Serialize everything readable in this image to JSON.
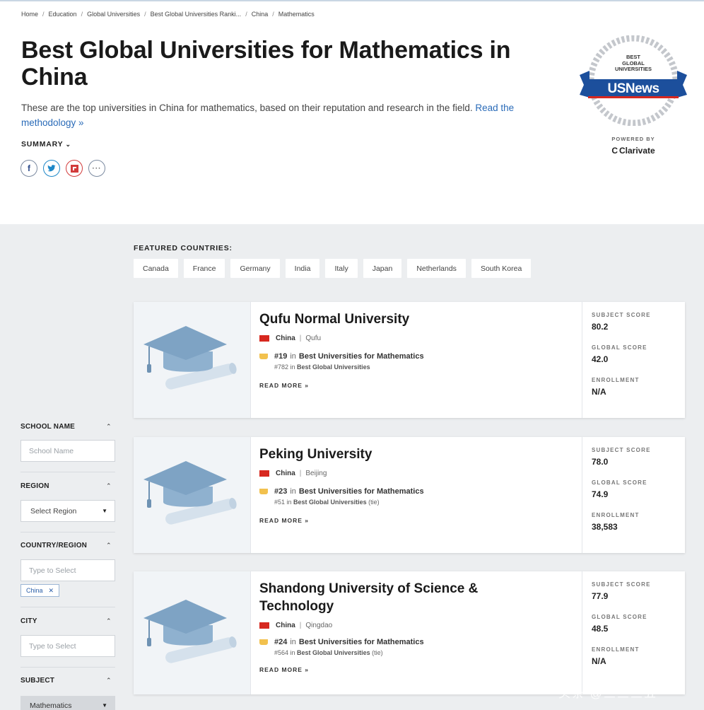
{
  "breadcrumb": [
    "Home",
    "Education",
    "Global Universities",
    "Best Global Universities Ranki...",
    "China",
    "Mathematics"
  ],
  "header": {
    "title": "Best Global Universities for Mathematics in China",
    "intro": "These are the top universities in China for mathematics, based on their reputation and research in the field.",
    "methodology_link": "Read the methodology »",
    "summary_label": "SUMMARY",
    "share_icons": [
      "facebook-icon",
      "twitter-icon",
      "flipboard-icon",
      "more-icon"
    ]
  },
  "badge": {
    "line1": "BEST",
    "line2": "GLOBAL",
    "line3": "UNIVERSITIES",
    "brand": "USNews",
    "powered_by": "POWERED BY",
    "partner": "Clarivate"
  },
  "featured": {
    "label": "FEATURED COUNTRIES:",
    "countries": [
      "Canada",
      "France",
      "Germany",
      "India",
      "Italy",
      "Japan",
      "Netherlands",
      "South Korea"
    ]
  },
  "filters": {
    "school_name": {
      "label": "SCHOOL NAME",
      "placeholder": "School Name"
    },
    "region": {
      "label": "REGION",
      "value": "Select Region"
    },
    "country_region": {
      "label": "COUNTRY/REGION",
      "placeholder": "Type to Select",
      "tag": "China"
    },
    "city": {
      "label": "CITY",
      "placeholder": "Type to Select"
    },
    "subject": {
      "label": "SUBJECT",
      "value": "Mathematics"
    }
  },
  "universities": [
    {
      "name": "Qufu Normal University",
      "country": "China",
      "city": "Qufu",
      "subject_rank": "#19",
      "subject_list": "Best Universities for Mathematics",
      "global_rank": "#782",
      "global_list": "Best Global Universities",
      "global_suffix": "",
      "read_more": "READ MORE »",
      "subject_score_label": "SUBJECT SCORE",
      "subject_score": "80.2",
      "global_score_label": "GLOBAL SCORE",
      "global_score": "42.0",
      "enrollment_label": "ENROLLMENT",
      "enrollment": "N/A"
    },
    {
      "name": "Peking University",
      "country": "China",
      "city": "Beijing",
      "subject_rank": "#23",
      "subject_list": "Best Universities for Mathematics",
      "global_rank": "#51",
      "global_list": "Best Global Universities",
      "global_suffix": "(tie)",
      "read_more": "READ MORE »",
      "subject_score_label": "SUBJECT SCORE",
      "subject_score": "78.0",
      "global_score_label": "GLOBAL SCORE",
      "global_score": "74.9",
      "enrollment_label": "ENROLLMENT",
      "enrollment": "38,583"
    },
    {
      "name": "Shandong University of Science & Technology",
      "country": "China",
      "city": "Qingdao",
      "subject_rank": "#24",
      "subject_list": "Best Universities for Mathematics",
      "global_rank": "#564",
      "global_list": "Best Global Universities",
      "global_suffix": "(tie)",
      "read_more": "READ MORE »",
      "subject_score_label": "SUBJECT SCORE",
      "subject_score": "77.9",
      "global_score_label": "GLOBAL SCORE",
      "global_score": "48.5",
      "enrollment_label": "ENROLLMENT",
      "enrollment": "N/A"
    }
  ],
  "watermark": "头条 @三三三五",
  "colors": {
    "link": "#2a6bb8",
    "brand_blue": "#1c4f9c",
    "brand_red": "#d7281f",
    "grey_bg": "#eceef0"
  }
}
